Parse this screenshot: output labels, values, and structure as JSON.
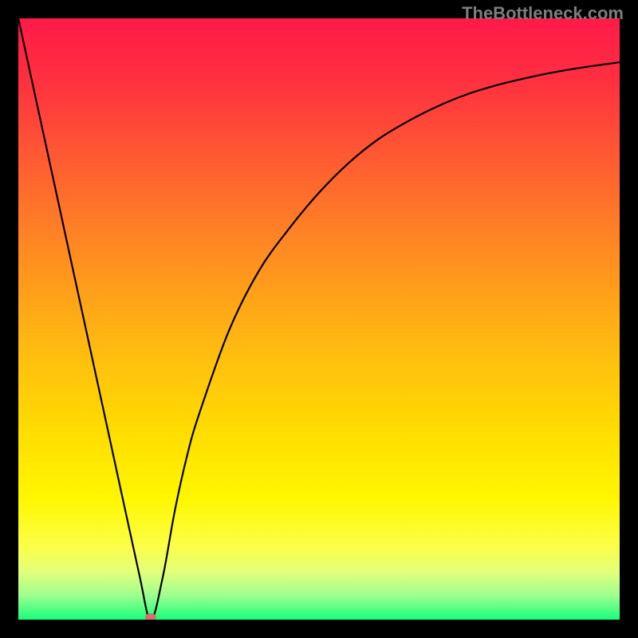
{
  "attribution": "TheBottleneck.com",
  "chart_data": {
    "type": "line",
    "title": "",
    "xlabel": "",
    "ylabel": "",
    "xlim": [
      0,
      100
    ],
    "ylim": [
      0,
      100
    ],
    "x": [
      0,
      5,
      10,
      15,
      20,
      22,
      24,
      26,
      28,
      30,
      35,
      40,
      45,
      50,
      55,
      60,
      65,
      70,
      75,
      80,
      85,
      90,
      95,
      100
    ],
    "values": [
      100,
      77,
      54,
      31,
      8,
      0,
      7,
      18,
      27,
      34,
      48,
      58,
      65,
      71,
      76,
      80,
      83,
      85.5,
      87.5,
      89,
      90.2,
      91.2,
      92,
      92.7
    ],
    "minimum_x": 22,
    "marker": {
      "x": 22,
      "y": 0,
      "color": "#d2726e",
      "rx": 7,
      "ry": 5
    },
    "gradient_stops": [
      {
        "offset": 0.0,
        "color": "#ff1a49"
      },
      {
        "offset": 0.1,
        "color": "#ff2f40"
      },
      {
        "offset": 0.25,
        "color": "#ff6030"
      },
      {
        "offset": 0.4,
        "color": "#ff8f20"
      },
      {
        "offset": 0.55,
        "color": "#ffbb10"
      },
      {
        "offset": 0.7,
        "color": "#ffe000"
      },
      {
        "offset": 0.8,
        "color": "#fff700"
      },
      {
        "offset": 0.88,
        "color": "#fbff4a"
      },
      {
        "offset": 0.92,
        "color": "#e4ff7a"
      },
      {
        "offset": 0.96,
        "color": "#9dff90"
      },
      {
        "offset": 1.0,
        "color": "#18ff7a"
      }
    ]
  }
}
